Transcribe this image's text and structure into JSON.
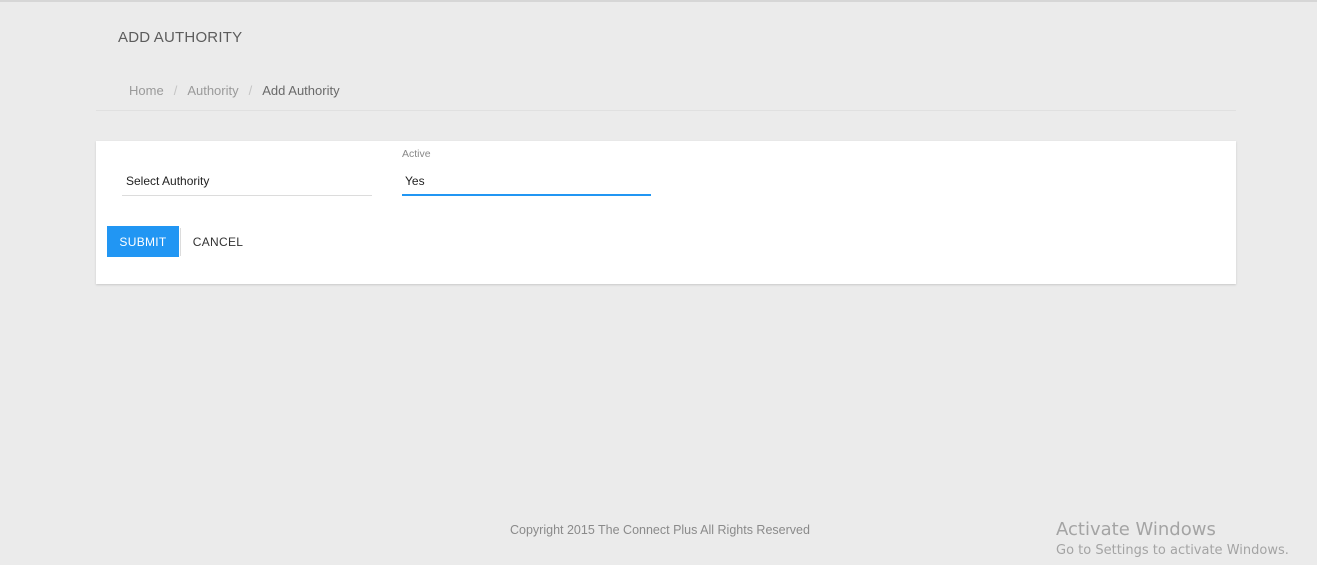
{
  "header": {
    "title": "ADD AUTHORITY"
  },
  "breadcrumb": {
    "items": [
      {
        "label": "Home"
      },
      {
        "label": "Authority"
      },
      {
        "label": "Add Authority"
      }
    ],
    "separator": "/"
  },
  "form": {
    "authority_select": {
      "value": "Select Authority"
    },
    "active_field": {
      "label": "Active",
      "value": "Yes"
    },
    "submit_label": "SUBMIT",
    "cancel_label": "CANCEL"
  },
  "footer": {
    "copyright": "Copyright 2015 The Connect Plus All Rights Reserved"
  },
  "watermark": {
    "title": "Activate Windows",
    "subtitle": "Go to Settings to activate Windows."
  },
  "colors": {
    "accent": "#2196f3",
    "background": "#ebebeb",
    "card": "#ffffff"
  }
}
